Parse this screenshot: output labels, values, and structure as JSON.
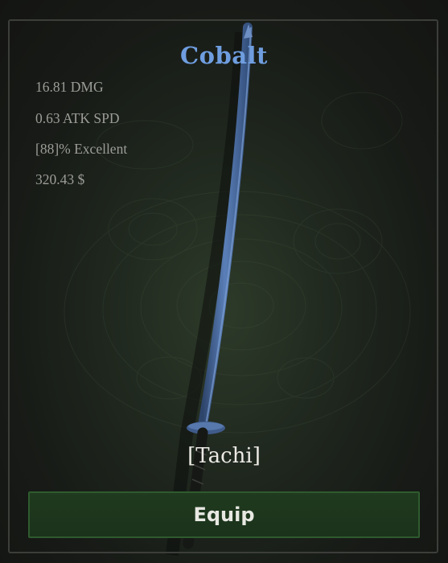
{
  "item": {
    "name": "Cobalt",
    "name_color": "#6f9ee0",
    "stats": {
      "damage": "16.81 DMG",
      "attack_speed": "0.63 ATK SPD",
      "quality": "[88]% Excellent",
      "price": "320.43 $"
    },
    "type": "[Tachi]",
    "blade_color": "#4a6a9c",
    "icon": "tachi-sword-icon"
  },
  "actions": {
    "equip_label": "Equip"
  }
}
